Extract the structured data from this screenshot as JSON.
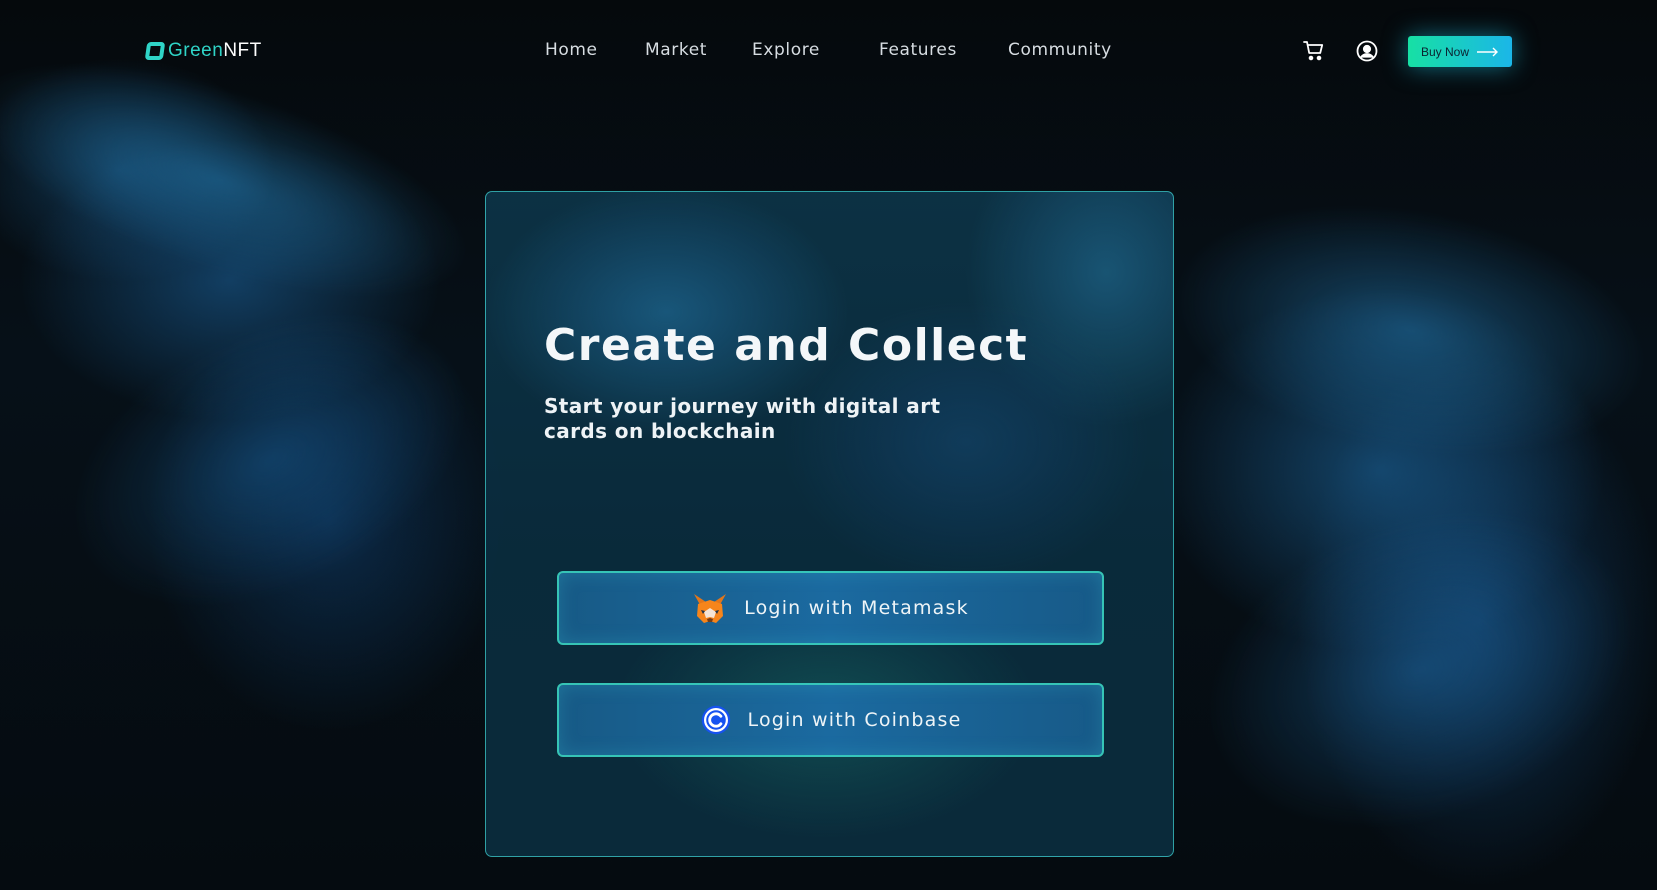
{
  "brand": {
    "name_part1": "Green",
    "name_part2": "NFT",
    "accent_color": "#2fd4c7"
  },
  "nav": {
    "items": [
      {
        "label": "Home"
      },
      {
        "label": "Market"
      },
      {
        "label": "Explore"
      },
      {
        "label": "Features"
      },
      {
        "label": "Community"
      }
    ]
  },
  "header_actions": {
    "cart_icon": "cart-icon",
    "account_icon": "user-circle-icon",
    "buy_label": "Buy Now",
    "buy_icon": "arrow-right-icon",
    "buy_gradient": [
      "#17e0a4",
      "#1bb6e8"
    ]
  },
  "hero": {
    "title": "Create and Collect",
    "subtitle": "Start your journey with digital art cards on blockchain"
  },
  "login": {
    "metamask_label": "Login with Metamask",
    "metamask_icon": "fox-icon",
    "coinbase_label": "Login with Coinbase",
    "coinbase_icon": "coinbase-icon",
    "coinbase_color": "#1652f0"
  }
}
